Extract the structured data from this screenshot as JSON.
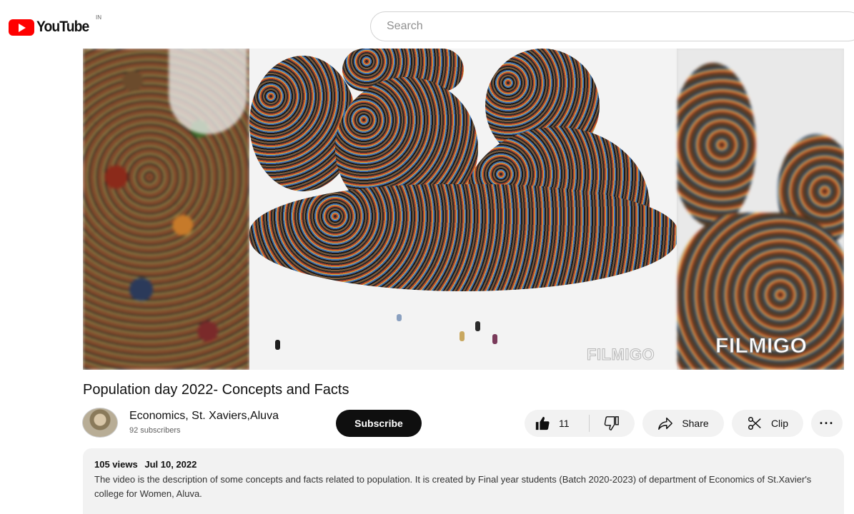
{
  "header": {
    "logo_text": "YouTube",
    "region": "IN",
    "search_placeholder": "Search"
  },
  "video": {
    "watermark_left": "FILMIGO",
    "watermark_right": "FILMIGO",
    "title": "Population day 2022- Concepts and Facts"
  },
  "channel": {
    "name": "Economics, St. Xaviers,Aluva",
    "subscribers": "92 subscribers",
    "subscribe_label": "Subscribe"
  },
  "actions": {
    "like_count": "11",
    "share_label": "Share",
    "clip_label": "Clip",
    "more_label": "···"
  },
  "description": {
    "views": "105 views",
    "date": "Jul 10, 2022",
    "text": "The video is the description of some concepts and facts related to population. It is created by Final year students (Batch 2020-2023) of department of Economics of St.Xavier's college for Women, Aluva."
  },
  "colors": {
    "brand_red": "#ff0000",
    "subscribe_bg": "#0f0f0f",
    "pill_bg": "#f2f2f2"
  }
}
